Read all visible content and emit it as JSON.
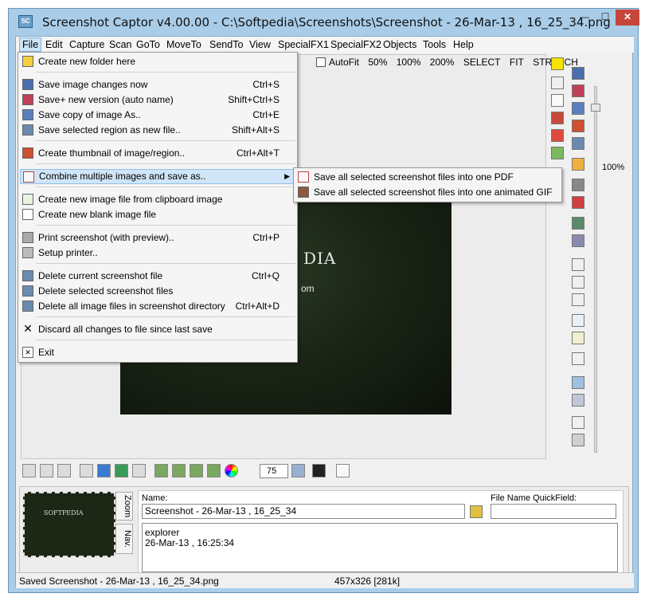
{
  "window": {
    "title": "Screenshot Captor v4.00.00 - C:\\Softpedia\\Screenshots\\Screenshot - 26-Mar-13 , 16_25_34.png",
    "app_icon": "SC",
    "minimize_glyph": "—",
    "maximize_glyph": "☐",
    "close_glyph": "✕"
  },
  "menubar": {
    "items": [
      "File",
      "Edit",
      "Capture",
      "Scan",
      "GoTo",
      "MoveTo",
      "SendTo",
      "View",
      "SpecialFX1",
      "SpecialFX2",
      "Objects",
      "Tools",
      "Help"
    ]
  },
  "file_menu": {
    "items": [
      {
        "label": "Create new folder here",
        "shortcut": "",
        "icon": "folder-star-icon"
      },
      {
        "label": "Save image changes now",
        "shortcut": "Ctrl+S",
        "icon": "floppy-icon"
      },
      {
        "label": "Save+ new version (auto name)",
        "shortcut": "Shift+Ctrl+S",
        "icon": "floppy-plus-icon"
      },
      {
        "label": "Save copy of image As..",
        "shortcut": "Ctrl+E",
        "icon": "save-as-icon"
      },
      {
        "label": "Save selected region as new file..",
        "shortcut": "Shift+Alt+S",
        "icon": "save-region-icon"
      },
      {
        "label": "Create thumbnail of image/region..",
        "shortcut": "Ctrl+Alt+T",
        "icon": "thumbnail-icon"
      },
      {
        "label": "Combine multiple images and save as..",
        "shortcut": "",
        "icon": "pdf-icon",
        "arrow": "▶"
      },
      {
        "label": "Create new image file from clipboard image",
        "shortcut": "",
        "icon": "new-clipboard-icon"
      },
      {
        "label": "Create new blank image file",
        "shortcut": "",
        "icon": "blank-page-icon"
      },
      {
        "label": "Print screenshot (with preview)..",
        "shortcut": "Ctrl+P",
        "icon": "printer-icon"
      },
      {
        "label": "Setup printer..",
        "shortcut": "",
        "icon": "printer-setup-icon"
      },
      {
        "label": "Delete current screenshot file",
        "shortcut": "Ctrl+Q",
        "icon": "delete-file-icon"
      },
      {
        "label": "Delete selected screenshot files",
        "shortcut": "",
        "icon": "delete-selected-icon"
      },
      {
        "label": "Delete all image files in screenshot directory",
        "shortcut": "Ctrl+Alt+D",
        "icon": "delete-all-icon"
      },
      {
        "label": "Discard all changes to file since last save",
        "shortcut": "",
        "icon": "discard-x-icon"
      },
      {
        "label": "Exit",
        "shortcut": "",
        "icon": "exit-icon"
      }
    ]
  },
  "submenu": {
    "items": [
      {
        "label": "Save all selected screenshot files into one PDF",
        "icon": "pdf-icon"
      },
      {
        "label": "Save all selected screenshot files into one animated GIF",
        "icon": "film-icon"
      }
    ]
  },
  "zoombar": {
    "autofit_label": "AutoFit",
    "options": [
      "50%",
      "100%",
      "200%",
      "SELECT",
      "FIT",
      "STRETCH"
    ]
  },
  "canvas": {
    "image_text1": "DIA",
    "image_text2": "om"
  },
  "zoom_slider": {
    "label": "100%",
    "value_percent": 100
  },
  "bottom_toolbar": {
    "spin_value": "75"
  },
  "lower_panel": {
    "thumb_text": "SOFTPEDIA",
    "tab_zoom": "Zoom",
    "tab_nav": "Nav.",
    "name_label": "Name:",
    "name_value": "Screenshot - 26-Mar-13 , 16_25_34",
    "quickfield_label": "File Name QuickField:",
    "quickfield_value": "",
    "notes_line1": "explorer",
    "notes_line2": "26-Mar-13 , 16:25:34"
  },
  "statusbar": {
    "left": "Saved Screenshot - 26-Mar-13 , 16_25_34.png",
    "center": "457x326  [281k]"
  },
  "colors": {
    "title_bg": "#a9cde8",
    "highlight": "#d0e5f7",
    "close_button": "#c7463a"
  }
}
